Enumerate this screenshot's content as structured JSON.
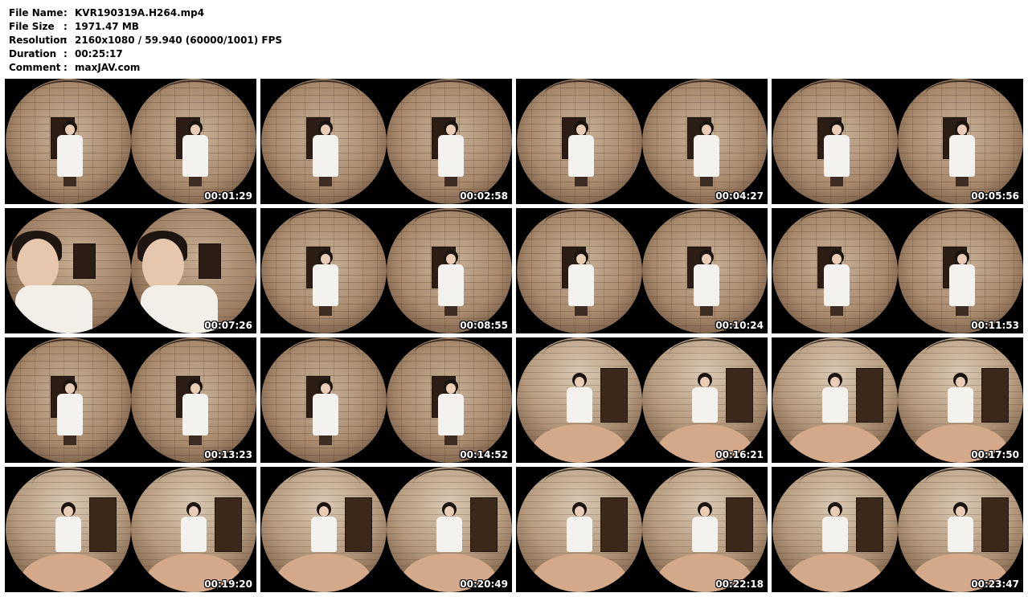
{
  "info": {
    "file_name": {
      "label": "File Name",
      "value": "KVR190319A.H264.mp4"
    },
    "file_size": {
      "label": "File Size",
      "value": "1971.47 MB"
    },
    "resolution": {
      "label": "Resolution",
      "value": "2160x1080 / 59.940 (60000/1001) FPS"
    },
    "duration": {
      "label": "Duration",
      "value": "00:25:17"
    },
    "comment": {
      "label": "Comment",
      "value": "maxJAV.com"
    },
    "separator": ":"
  },
  "thumbnails": [
    {
      "time": "00:01:29",
      "scene": "standing"
    },
    {
      "time": "00:02:58",
      "scene": "standing"
    },
    {
      "time": "00:04:27",
      "scene": "standing"
    },
    {
      "time": "00:05:56",
      "scene": "standing"
    },
    {
      "time": "00:07:26",
      "scene": "closeup"
    },
    {
      "time": "00:08:55",
      "scene": "standing"
    },
    {
      "time": "00:10:24",
      "scene": "standing"
    },
    {
      "time": "00:11:53",
      "scene": "standing"
    },
    {
      "time": "00:13:23",
      "scene": "standing"
    },
    {
      "time": "00:14:52",
      "scene": "standing"
    },
    {
      "time": "00:16:21",
      "scene": "pov"
    },
    {
      "time": "00:17:50",
      "scene": "pov"
    },
    {
      "time": "00:19:20",
      "scene": "pov"
    },
    {
      "time": "00:20:49",
      "scene": "pov"
    },
    {
      "time": "00:22:18",
      "scene": "pov"
    },
    {
      "time": "00:23:47",
      "scene": "pov"
    }
  ]
}
